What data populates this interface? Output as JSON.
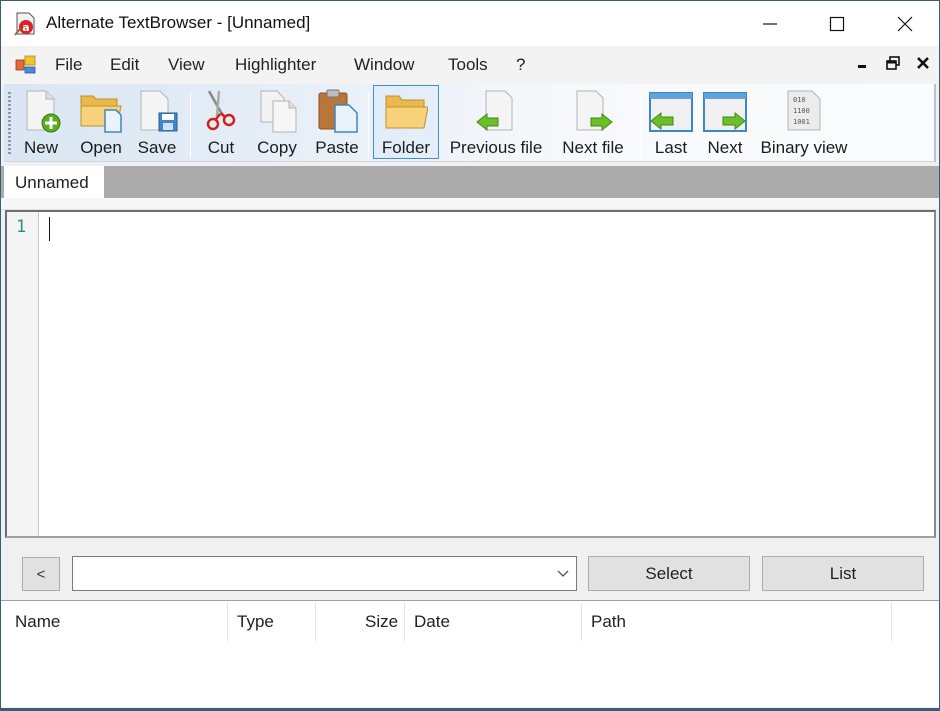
{
  "window": {
    "title": "Alternate TextBrowser - [Unnamed]",
    "controls": [
      "minimize",
      "maximize",
      "close"
    ]
  },
  "menu": {
    "items": [
      "File",
      "Edit",
      "View",
      "Highlighter",
      "Window",
      "Tools",
      "?"
    ],
    "mdi_controls": [
      "minimize",
      "restore",
      "close"
    ]
  },
  "toolbar": {
    "buttons": [
      {
        "label": "New",
        "icon": "new-file-icon"
      },
      {
        "label": "Open",
        "icon": "open-folder-icon"
      },
      {
        "label": "Save",
        "icon": "save-icon"
      },
      {
        "label": "Cut",
        "icon": "scissors-icon"
      },
      {
        "label": "Copy",
        "icon": "copy-icon"
      },
      {
        "label": "Paste",
        "icon": "paste-icon"
      },
      {
        "label": "Folder",
        "icon": "folder-icon",
        "active": true
      },
      {
        "label": "Previous file",
        "icon": "previous-file-icon"
      },
      {
        "label": "Next file",
        "icon": "next-file-icon"
      },
      {
        "label": "Last",
        "icon": "last-window-icon"
      },
      {
        "label": "Next",
        "icon": "next-window-icon"
      },
      {
        "label": "Binary view",
        "icon": "binary-view-icon"
      }
    ],
    "binary_icon_text": [
      "010",
      "1100",
      "1001"
    ]
  },
  "tabs": [
    {
      "label": "Unnamed",
      "active": true
    }
  ],
  "editor": {
    "line_numbers": [
      "1"
    ],
    "content": ""
  },
  "search": {
    "back_label": "<",
    "combo_value": "",
    "select_label": "Select",
    "list_label": "List"
  },
  "filelist": {
    "columns": [
      "Name",
      "Type",
      "Size",
      "Date",
      "Path"
    ],
    "rows": []
  },
  "colors": {
    "accent": "#3f8fd2",
    "line_number": "#2a8a92",
    "tabstrip": "#ababab",
    "window_border": "#3b5d75"
  }
}
